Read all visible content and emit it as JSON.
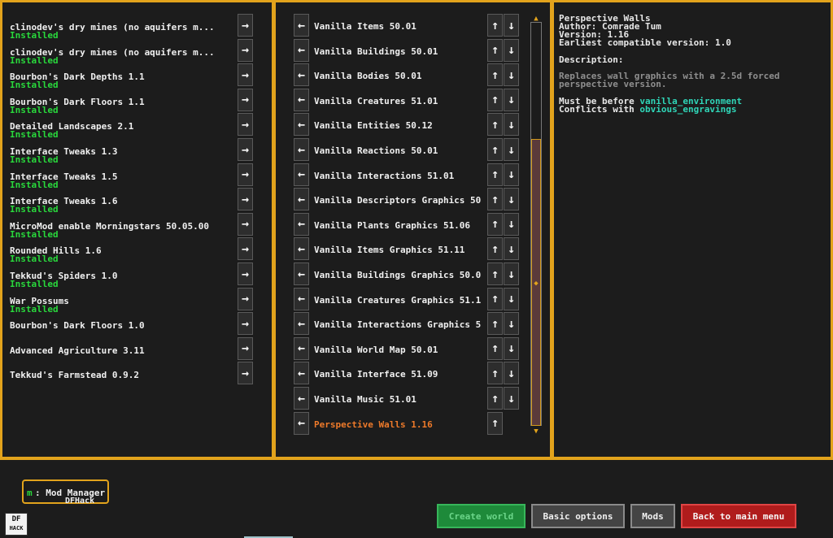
{
  "available_mods": [
    {
      "name": "clinodev's dry mines (no aquifers m...",
      "status": "Installed"
    },
    {
      "name": "clinodev's dry mines (no aquifers m...",
      "status": "Installed"
    },
    {
      "name": "Bourbon's Dark Depths 1.1",
      "status": "Installed"
    },
    {
      "name": "Bourbon's Dark Floors 1.1",
      "status": "Installed"
    },
    {
      "name": "Detailed Landscapes 2.1",
      "status": "Installed"
    },
    {
      "name": "Interface Tweaks 1.3",
      "status": "Installed"
    },
    {
      "name": "Interface Tweaks 1.5",
      "status": "Installed"
    },
    {
      "name": "Interface Tweaks 1.6",
      "status": "Installed"
    },
    {
      "name": "MicroMod enable Morningstars 50.05.00",
      "status": "Installed"
    },
    {
      "name": "Rounded Hills 1.6",
      "status": "Installed"
    },
    {
      "name": "Tekkud's Spiders 1.0",
      "status": "Installed"
    },
    {
      "name": "War Possums",
      "status": "Installed"
    },
    {
      "name": "Bourbon's Dark Floors 1.0",
      "status": ""
    },
    {
      "name": "Advanced Agriculture 3.11",
      "status": ""
    },
    {
      "name": "Tekkud's Farmstead 0.9.2",
      "status": ""
    }
  ],
  "active_mods": [
    "Vanilla Items 50.01",
    "Vanilla Buildings 50.01",
    "Vanilla Bodies 50.01",
    "Vanilla Creatures 51.01",
    "Vanilla Entities 50.12",
    "Vanilla Reactions 50.01",
    "Vanilla Interactions 51.01",
    "Vanilla Descriptors Graphics 50",
    "Vanilla Plants Graphics 51.06",
    "Vanilla Items Graphics 51.11",
    "Vanilla Buildings Graphics 50.0",
    "Vanilla Creatures Graphics 51.1",
    "Vanilla Interactions Graphics 5",
    "Vanilla World Map 50.01",
    "Vanilla Interface 51.09",
    "Vanilla Music 51.01",
    "Perspective Walls 1.16"
  ],
  "icons": {
    "add": "→",
    "remove": "←",
    "up": "↑",
    "down": "↓",
    "scroll_up": "▲",
    "scroll_mid": "◆",
    "scroll_down": "▼"
  },
  "details": {
    "title": "Perspective Walls",
    "author": "Author: Comrade Tum",
    "version": "Version: 1.16",
    "earliest": "Earliest compatible version: 1.0",
    "description_label": "Description:",
    "description_1": "Replaces wall graphics with a 2.5d forced",
    "description_2": "perspective version.",
    "before_prefix": "Must be before ",
    "before_mod": "vanilla_environment",
    "conflicts_prefix": "Conflicts with ",
    "conflicts_mod": "obvious_engravings"
  },
  "mod_manager": {
    "key": "m",
    "label": ": Mod Manager",
    "sub": "DFHack"
  },
  "logo": {
    "line1": "DF",
    "line2": "HACK"
  },
  "buttons": {
    "create": "Create world",
    "basic": "Basic options",
    "mods": "Mods",
    "back": "Back to main menu"
  },
  "colors": {
    "frame": "#e2a31c",
    "installed": "#29d83c",
    "selected": "#ee7a2a",
    "link": "#2fd6b8",
    "create": "#1e8a3a",
    "back": "#b01c1c"
  }
}
